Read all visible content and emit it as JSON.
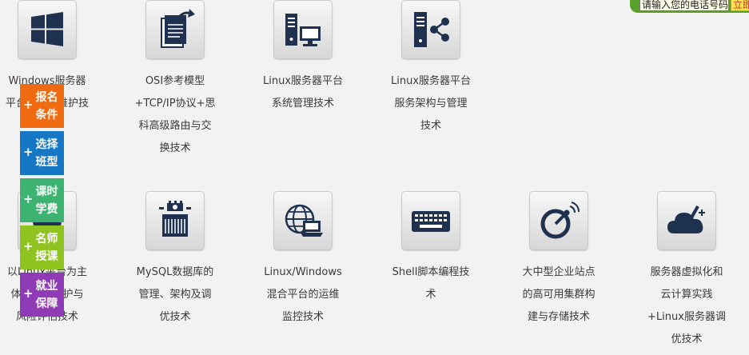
{
  "courses_row1": [
    {
      "icon": "windows-logo-icon",
      "lines": [
        "Windows服务器",
        "平台管理与维护技"
      ]
    },
    {
      "icon": "document-export-icon",
      "lines": [
        "OSI参考模型",
        "+TCP/IP协议+思",
        "科高级路由与交",
        "换技术"
      ]
    },
    {
      "icon": "server-monitor-icon",
      "lines": [
        "Linux服务器平台",
        "系统管理技术"
      ]
    },
    {
      "icon": "server-share-icon",
      "lines": [
        "Linux服务器平台",
        "服务架构与管理",
        "技术"
      ]
    }
  ],
  "courses_row2": [
    {
      "icon": "security-icon",
      "lines": [
        "以Linux平台为主",
        "体的系统维护与",
        "风险评估技术"
      ]
    },
    {
      "icon": "database-chip-icon",
      "lines": [
        "MySQL数据库的",
        "管理、架构及调",
        "优技术"
      ]
    },
    {
      "icon": "globe-laptop-icon",
      "lines": [
        "Linux/Windows",
        "混合平台的运维",
        "监控技术"
      ]
    },
    {
      "icon": "keyboard-icon",
      "lines": [
        "Shell脚本编程技",
        "术"
      ]
    },
    {
      "icon": "satellite-dish-icon",
      "lines": [
        "大中型企业站点",
        "的高可用集群构",
        "建与存储技术"
      ]
    },
    {
      "icon": "cloud-edit-icon",
      "lines": [
        "服务器虚拟化和",
        "云计算实践",
        "+Linux服务器调",
        "优技术"
      ]
    }
  ],
  "side_nav": [
    {
      "line1": "报名",
      "line2": "条件",
      "color": "#f06a0f"
    },
    {
      "line1": "选择",
      "line2": "班型",
      "color": "#1677c5"
    },
    {
      "line1": "课时",
      "line2": "学费",
      "color": "#3cb371"
    },
    {
      "line1": "名师",
      "line2": "授课",
      "color": "#8fc31f"
    },
    {
      "line1": "就业",
      "line2": "保障",
      "color": "#8e3bb5"
    }
  ],
  "side_plus": "+",
  "phone": {
    "placeholder": "请输入您的电话号码",
    "button": "立即"
  }
}
